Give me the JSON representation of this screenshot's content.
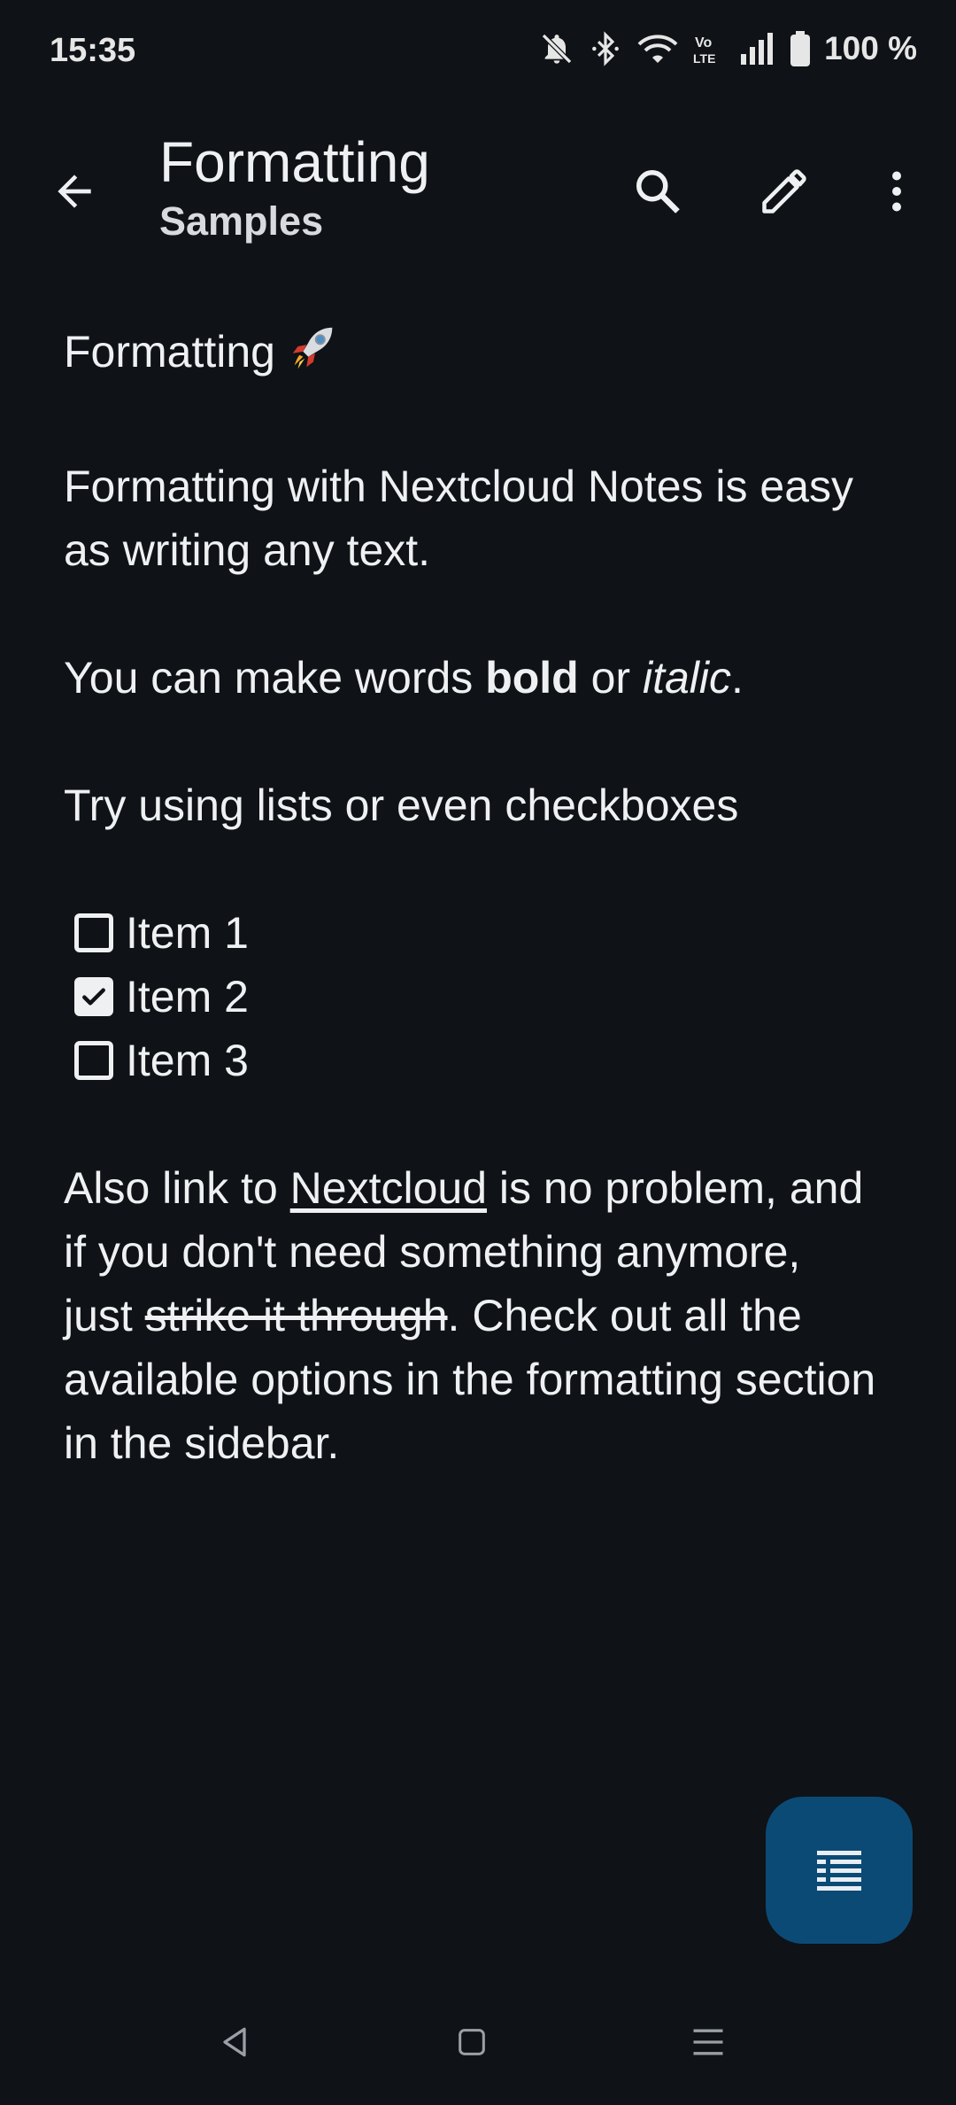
{
  "status_bar": {
    "time": "15:35",
    "battery_text": "100 %",
    "icons": [
      "bell-muted-icon",
      "bluetooth-icon",
      "wifi-icon",
      "volte-icon",
      "signal-icon",
      "battery-icon"
    ]
  },
  "app_bar": {
    "title": "Formatting",
    "subtitle": "Samples",
    "icons": [
      "back-arrow-icon",
      "search-icon",
      "edit-pencil-icon",
      "more-vert-icon"
    ]
  },
  "note": {
    "heading": "Formatting",
    "heading_emoji": "rocket-icon",
    "intro": "Formatting with Nextcloud Notes is easy as writing any text.",
    "bold_line": {
      "before": "You can make words ",
      "bold": "bold",
      "middle": " or ",
      "italic": "italic",
      "after": "."
    },
    "lists_line": "Try using lists or even checkboxes",
    "checklist": [
      {
        "label": "Item 1",
        "checked": false
      },
      {
        "label": "Item 2",
        "checked": true
      },
      {
        "label": "Item 3",
        "checked": false
      }
    ],
    "link_para": {
      "before": "Also link to ",
      "link": "Nextcloud",
      "middle": " is no problem, and if you don't need something anymore, just ",
      "strike": "strike it through",
      "after": ". Check out all the available options in the formatting section in the sidebar."
    }
  },
  "fab": {
    "icon": "toc-icon",
    "color": "#0b4a75"
  },
  "nav_bar": {
    "icons": [
      "nav-back-icon",
      "nav-home-icon",
      "nav-recents-icon"
    ]
  },
  "colors": {
    "background": "#0f1216",
    "text": "#eef0f2",
    "accent": "#0b4a75"
  }
}
